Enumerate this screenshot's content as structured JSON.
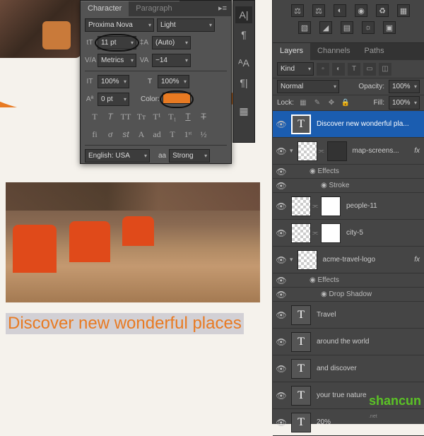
{
  "canvas": {
    "headline": "Discover new wonderful places"
  },
  "character_panel": {
    "tab_character": "Character",
    "tab_paragraph": "Paragraph",
    "font_family": "Proxima Nova",
    "font_style": "Light",
    "font_size": "11 pt",
    "leading": "(Auto)",
    "kerning": "Metrics",
    "tracking": "−14",
    "v_scale": "100%",
    "h_scale": "100%",
    "baseline": "0 pt",
    "color_label": "Color:",
    "color_hex": "#e87a22",
    "language": "English: USA",
    "aa_label": "aa",
    "aa_mode": "Strong"
  },
  "layers_panel": {
    "tab_layers": "Layers",
    "tab_channels": "Channels",
    "tab_paths": "Paths",
    "kind_filter": "Kind",
    "blend_mode": "Normal",
    "opacity_label": "Opacity:",
    "opacity_value": "100%",
    "lock_label": "Lock:",
    "fill_label": "Fill:",
    "fill_value": "100%",
    "effects_label": "Effects",
    "stroke_label": "Stroke",
    "dropshadow_label": "Drop Shadow",
    "fx_label": "fx",
    "layers": [
      {
        "name": "Discover new wonderful pla...",
        "type": "text",
        "selected": true
      },
      {
        "name": "map-screens...",
        "type": "smart",
        "fx": true,
        "effects": [
          "Stroke"
        ]
      },
      {
        "name": "people-11",
        "type": "smart"
      },
      {
        "name": "city-5",
        "type": "smart"
      },
      {
        "name": "acme-travel-logo",
        "type": "smart",
        "fx": true,
        "effects": [
          "Drop Shadow"
        ]
      },
      {
        "name": "Travel",
        "type": "text"
      },
      {
        "name": "around the world",
        "type": "text"
      },
      {
        "name": "and discover",
        "type": "text"
      },
      {
        "name": "your true nature",
        "type": "text"
      },
      {
        "name": "20%",
        "type": "text"
      }
    ]
  },
  "watermark": {
    "brand": "shancun",
    "domain": ".net"
  }
}
